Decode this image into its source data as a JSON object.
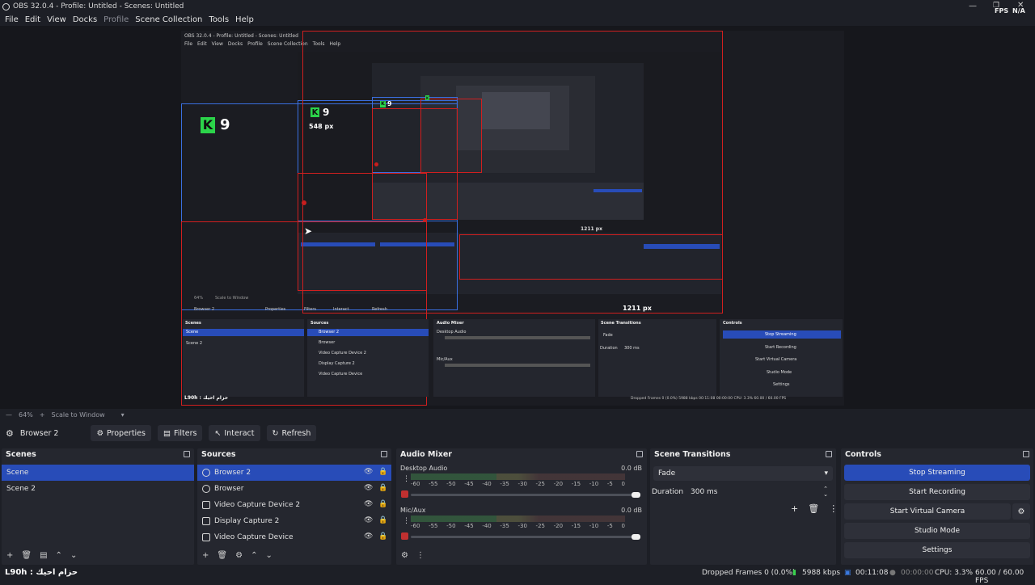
{
  "window": {
    "title": "OBS 32.0.4 - Profile: Untitled - Scenes: Untitled",
    "fps_label": "FPS",
    "fps_value": "N/A"
  },
  "menu": [
    "File",
    "Edit",
    "View",
    "Docks",
    "Profile",
    "Scene Collection",
    "Tools",
    "Help"
  ],
  "nested_preview": {
    "title": "OBS 32.0.4 - Profile: Untitled - Scenes: Untitled",
    "menu": [
      "File",
      "Edit",
      "View",
      "Docks",
      "Profile",
      "Scene Collection",
      "Tools",
      "Help"
    ],
    "k9_label": "9",
    "px_label_548": "548 px",
    "px_label_1211": "1211 px",
    "inner_px_1211": "1211 px",
    "scale_pct": "64%",
    "scale_mode": "Scale to Window",
    "source_name": "Browser 2",
    "buttons": [
      "Properties",
      "Filters",
      "Interact",
      "Refresh"
    ],
    "scenes_title": "Scenes",
    "scenes": [
      "Scene",
      "Scene 2"
    ],
    "sources_title": "Sources",
    "sources": [
      "Browser 2",
      "Browser",
      "Video Capture Device 2",
      "Display Capture 2",
      "Video Capture Device"
    ],
    "audio_title": "Audio Mixer",
    "audio_ch1": "Desktop Audio",
    "audio_ch2": "Mic/Aux",
    "db": "0.0 dB",
    "transitions_title": "Scene Transitions",
    "transition": "Fade",
    "duration_label": "Duration",
    "duration_value": "300 ms",
    "controls_title": "Controls",
    "controls": [
      "Stop Streaming",
      "Start Recording",
      "Start Virtual Camera",
      "Studio Mode",
      "Settings"
    ],
    "status": "Dropped Frames 0 (0.0%)   5988 kbps   00:11:08   00:00:00   CPU: 3.3%   60.00 / 60.00 FPS",
    "watermark": "L90h : حزام احيك"
  },
  "scale": {
    "percent": "64%",
    "mode": "Scale to Window"
  },
  "source_toolbar": {
    "source_name": "Browser 2",
    "properties": "Properties",
    "filters": "Filters",
    "interact": "Interact",
    "refresh": "Refresh"
  },
  "scenes": {
    "title": "Scenes",
    "items": [
      "Scene",
      "Scene 2"
    ]
  },
  "sources": {
    "title": "Sources",
    "items": [
      {
        "name": "Browser 2",
        "icon": "globe-icon"
      },
      {
        "name": "Browser",
        "icon": "globe-icon"
      },
      {
        "name": "Video Capture Device 2",
        "icon": "camera-icon"
      },
      {
        "name": "Display Capture 2",
        "icon": "monitor-icon"
      },
      {
        "name": "Video Capture Device",
        "icon": "camera-icon"
      }
    ]
  },
  "audio_mixer": {
    "title": "Audio Mixer",
    "channels": [
      {
        "name": "Desktop Audio",
        "db": "0.0 dB"
      },
      {
        "name": "Mic/Aux",
        "db": "0.0 dB"
      }
    ],
    "ticks": [
      "-60",
      "-55",
      "-50",
      "-45",
      "-40",
      "-35",
      "-30",
      "-25",
      "-20",
      "-15",
      "-10",
      "-5",
      "0"
    ]
  },
  "transitions": {
    "title": "Scene Transitions",
    "selected": "Fade",
    "duration_label": "Duration",
    "duration_value": "300 ms"
  },
  "controls": {
    "title": "Controls",
    "stop_streaming": "Stop Streaming",
    "start_recording": "Start Recording",
    "start_virtual_camera": "Start Virtual Camera",
    "studio_mode": "Studio Mode",
    "settings": "Settings"
  },
  "status": {
    "watermark": "L90h : حزام احيك",
    "dropped_frames": "Dropped Frames 0 (0.0%)",
    "bitrate": "5988 kbps",
    "stream_time": "00:11:08",
    "rec_time": "00:00:00",
    "cpu": "CPU: 3.3%",
    "fps": "60.00 / 60.00 FPS"
  },
  "colors": {
    "accent": "#284cb8",
    "bg": "#1d1f26",
    "dock": "#25272f",
    "selection_red": "#d01f1f",
    "k9_green": "#2bd44a"
  }
}
